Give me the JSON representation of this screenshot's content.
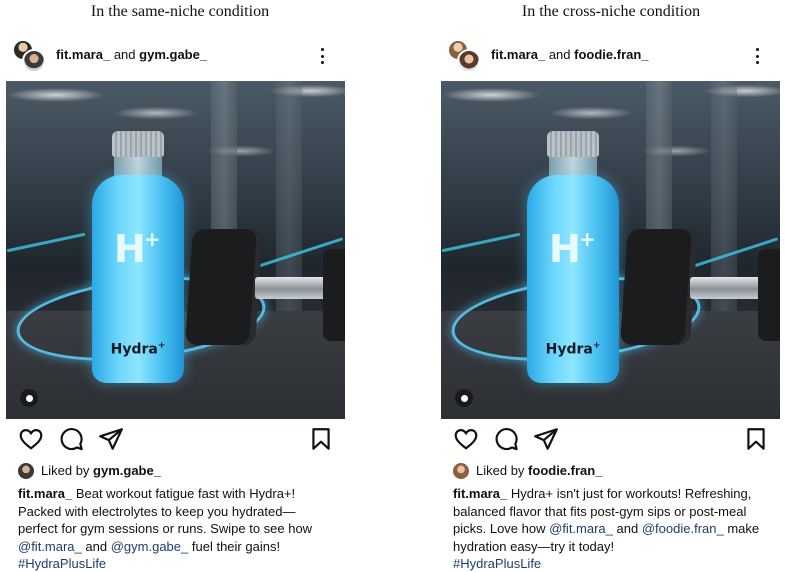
{
  "conditions": [
    {
      "title": "In the same-niche condition",
      "header": {
        "user1": "fit.mara_",
        "joiner": "and",
        "user2": "gym.gabe_"
      },
      "image": {
        "brand": "Hydra",
        "brand_plus": "+",
        "logo": "H",
        "logo_plus": "+"
      },
      "liked": {
        "prefix": "Liked by",
        "user": "gym.gabe_"
      },
      "caption": {
        "user": "fit.mara_",
        "line1": "Beat workout fatigue fast with Hydra+!",
        "line2": "Packed with electrolytes to keep you hydrated—",
        "line3": "perfect for gym sessions or runs. Swipe to see how",
        "mention1": "@fit.mara_",
        "and": "and",
        "mention2": "@gym.gabe_",
        "line4_end": "fuel their gains!",
        "hashtag": "#HydraPlusLife"
      }
    },
    {
      "title": "In the cross-niche condition",
      "header": {
        "user1": "fit.mara_",
        "joiner": "and",
        "user2": "foodie.fran_"
      },
      "image": {
        "brand": "Hydra",
        "brand_plus": "+",
        "logo": "H",
        "logo_plus": "+"
      },
      "liked": {
        "prefix": "Liked by",
        "user": "foodie.fran_"
      },
      "caption": {
        "user": "fit.mara_",
        "line1": "Hydra+ isn't just for workouts! Refreshing,",
        "line2": "balanced flavor that fits post-gym sips or post-meal",
        "line3_start": "picks. Love how",
        "mention1": "@fit.mara_",
        "and": "and",
        "mention2": "@foodie.fran_",
        "line3_end": "make",
        "line4": "hydration easy—try it today!",
        "hashtag": "#HydraPlusLife"
      }
    }
  ],
  "icons": [
    "heart-icon",
    "comment-icon",
    "share-icon",
    "bookmark-icon",
    "more-options-icon",
    "profile-tag-icon"
  ],
  "colors": {
    "mention": "#1f3d6b",
    "bottle": "#4cc2f2",
    "text": "#111111"
  }
}
